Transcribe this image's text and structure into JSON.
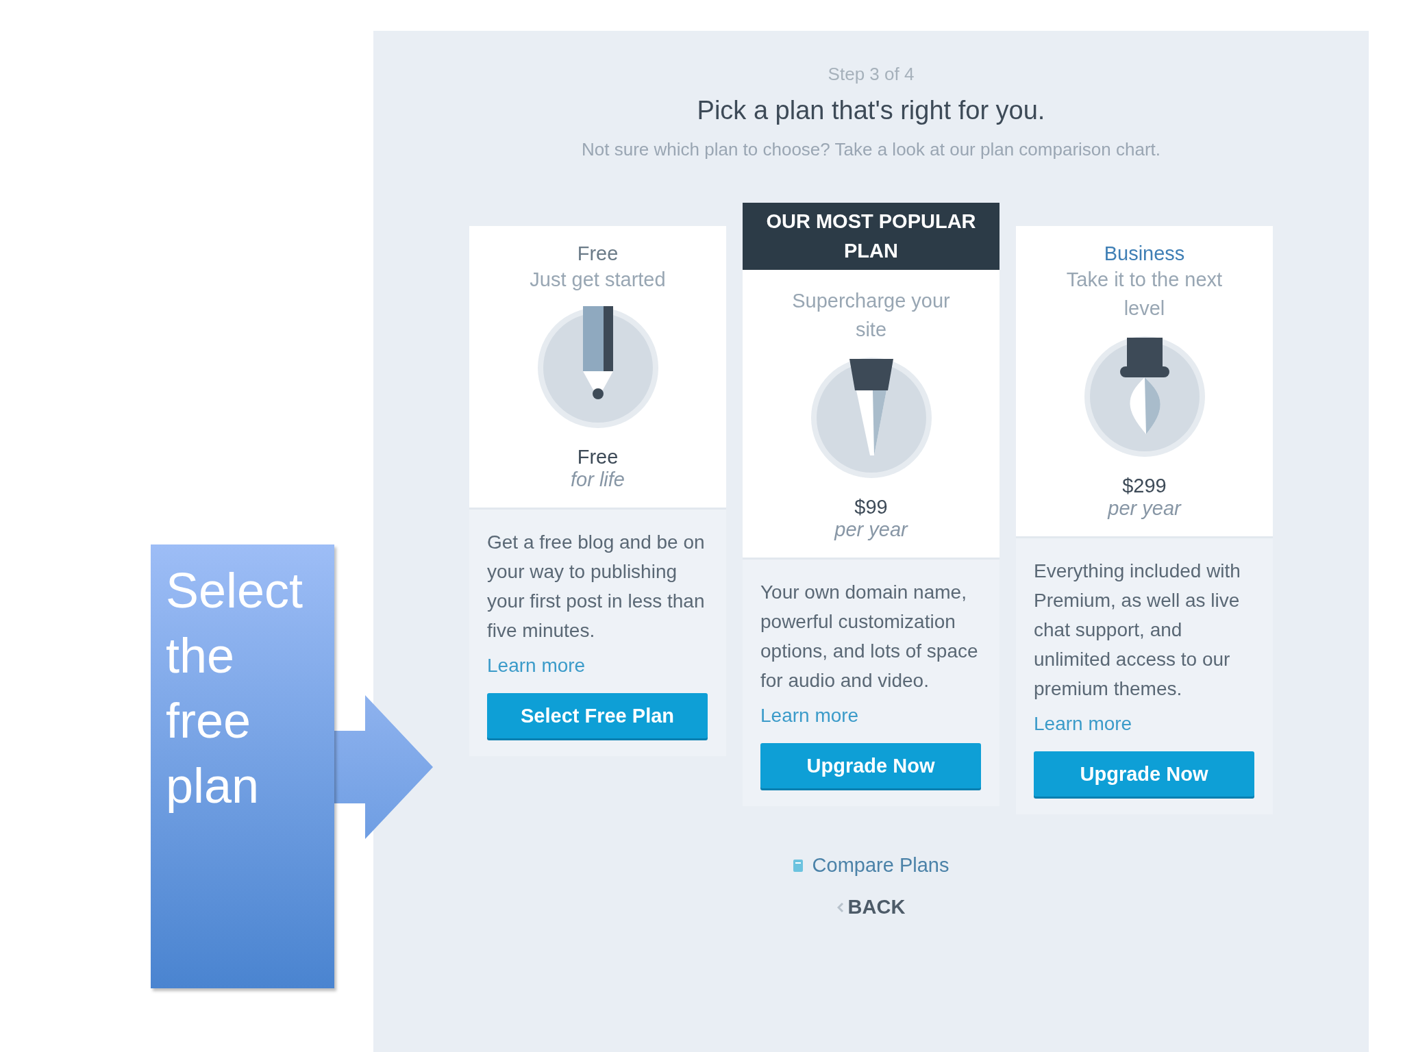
{
  "header": {
    "step": "Step 3 of 4",
    "title": "Pick a plan that's right for you.",
    "subtitle": "Not sure which plan to choose? Take a look at our plan comparison chart."
  },
  "plans": [
    {
      "name": "Free",
      "color": "#6b7b88",
      "tagline": "Just get started",
      "price": "Free",
      "period": "for life",
      "description": "Get a free blog and be on your way to publishing your first post in less than five minutes.",
      "link": "Learn more",
      "button": "Select Free Plan"
    },
    {
      "banner": "OUR MOST POPULAR PLAN",
      "tagline": "Supercharge your site",
      "price": "$99",
      "period": "per year",
      "description": "Your own domain name, powerful customization options, and lots of space for audio and video.",
      "link": "Learn more",
      "button": "Upgrade Now"
    },
    {
      "name": "Business",
      "color": "#3f7fb5",
      "tagline": "Take it to the next level",
      "price": "$299",
      "period": "per year",
      "description": "Everything included with Premium, as well as live chat support, and unlimited access to our premium themes.",
      "link": "Learn more",
      "button": "Upgrade Now"
    }
  ],
  "footer": {
    "compare": "Compare Plans",
    "back": "BACK"
  },
  "callout": {
    "text": "Select the free plan"
  }
}
